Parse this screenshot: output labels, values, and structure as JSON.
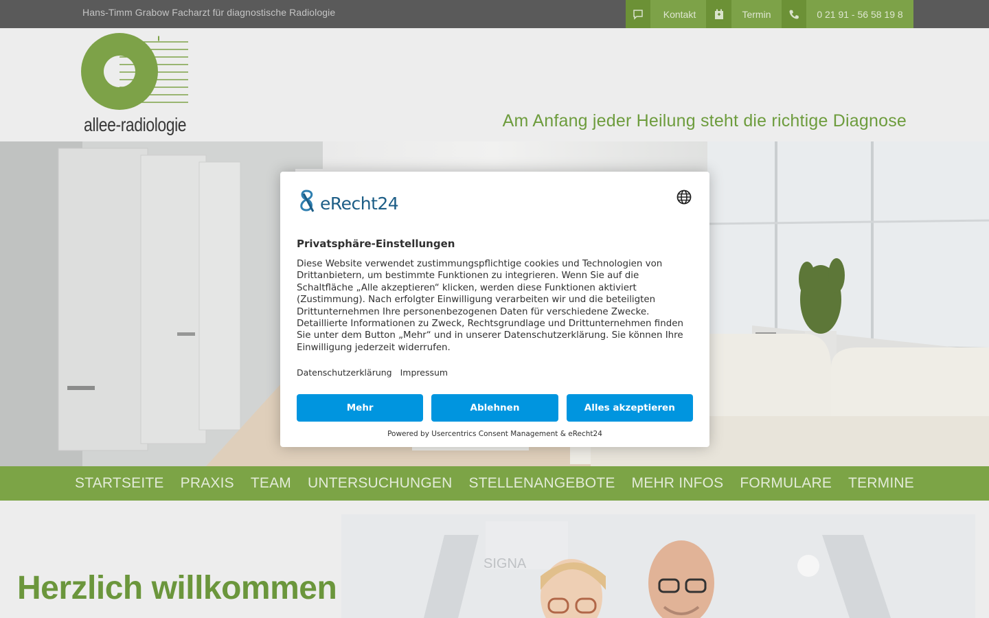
{
  "topbar": {
    "claim": "Hans-Timm Grabow Facharzt für diagnostische Radiologie",
    "links": [
      {
        "icon": "chat-icon",
        "label": "Kontakt"
      },
      {
        "icon": "calendar-icon",
        "label": "Termin"
      },
      {
        "icon": "phone-icon",
        "label": "0 21 91 - 56 58 19 8"
      }
    ]
  },
  "header": {
    "logo_text": "allee-radiologie",
    "tagline": "Am Anfang jeder Heilung steht die richtige Diagnose"
  },
  "nav": {
    "items": [
      "STARTSEITE",
      "PRAXIS",
      "TEAM",
      "UNTERSUCHUNGEN",
      "STELLENANGEBOTE",
      "MEHR INFOS",
      "FORMULARE",
      "TERMINE"
    ]
  },
  "content": {
    "welcome": "Herzlich willkommen",
    "image_label": "SIGNA"
  },
  "consent": {
    "brand": "eRecht24",
    "title": "Privatsphäre-Einstellungen",
    "description": "Diese Website verwendet zustimmungspflichtige cookies und Technologien von Drittanbietern, um bestimmte Funktionen zu integrieren. Wenn Sie auf die Schaltfläche „Alle akzeptieren“ klicken, werden diese Funktionen aktiviert (Zustimmung). Nach erfolgter Einwilligung verarbeiten wir und die beteiligten Drittunternehmen Ihre personenbezogenen Daten für verschiedene Zwecke. Detaillierte Informationen zu Zweck, Rechtsgrundlage und Drittunternehmen finden Sie unter dem Button „Mehr“ und in unserer Datenschutzerklärung. Sie können Ihre Einwilligung jederzeit widerrufen.",
    "link_privacy": "Datenschutzerklärung",
    "link_imprint": "Impressum",
    "btn_more": "Mehr",
    "btn_deny": "Ablehnen",
    "btn_accept": "Alles akzeptieren",
    "powered": "Powered by Usercentrics Consent Management & eRecht24",
    "colors": {
      "button": "#0095df",
      "brand": "#1c5d86"
    }
  },
  "colors": {
    "green": "#7fa848",
    "topbar": "#5c5c5c",
    "header_bg": "#f2f2f2"
  }
}
